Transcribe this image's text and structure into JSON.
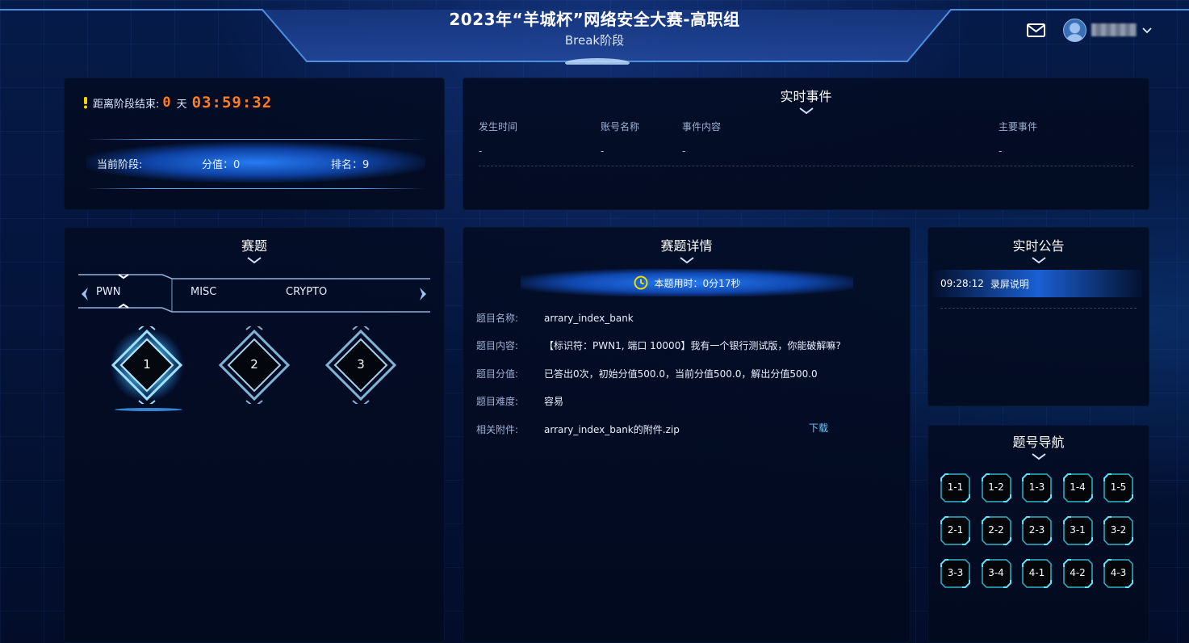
{
  "header": {
    "title": "2023年“羊城杯”网络安全大赛-高职组",
    "subtitle": "Break阶段",
    "username": "user"
  },
  "countdown": {
    "label": "距离阶段结束:",
    "days": "0",
    "days_unit": "天",
    "time": "03:59:32"
  },
  "stage": {
    "current_label": "当前阶段:",
    "score": "分值：0",
    "rank": "排名：9"
  },
  "events": {
    "title": "实时事件",
    "columns": [
      "发生时间",
      "账号名称",
      "事件内容",
      "主要事件"
    ],
    "row": [
      "-",
      "-",
      "-",
      "-"
    ]
  },
  "challenges": {
    "title": "赛题",
    "tabs": [
      "PWN",
      "MISC",
      "CRYPTO"
    ],
    "active_tab": "PWN",
    "items": [
      "1",
      "2",
      "3"
    ],
    "selected": "1"
  },
  "details": {
    "title": "赛题详情",
    "timer": "本题用时：0分17秒",
    "rows": [
      {
        "label": "题目名称:",
        "value": "arrary_index_bank"
      },
      {
        "label": "题目内容:",
        "value": "【标识符：PWN1, 端口 10000】我有一个银行测试版，你能破解嘛?"
      },
      {
        "label": "题目分值:",
        "value": "已答出0次，初始分值500.0，当前分值500.0，解出分值500.0"
      },
      {
        "label": "题目难度:",
        "value": "容易"
      },
      {
        "label": "相关附件:",
        "value": "arrary_index_bank的附件.zip"
      }
    ],
    "download": "下载"
  },
  "notices": {
    "title": "实时公告",
    "items": [
      {
        "time": "09:28:12",
        "text": "录屏说明"
      }
    ]
  },
  "nav": {
    "title": "题号导航",
    "items": [
      "1-1",
      "1-2",
      "1-3",
      "1-4",
      "1-5",
      "2-1",
      "2-2",
      "2-3",
      "3-1",
      "3-2",
      "3-3",
      "3-4",
      "4-1",
      "4-2",
      "4-3"
    ]
  },
  "colors": {
    "accent": "#1e7bff",
    "timer": "#ff7d1f",
    "link": "#6cc8ff"
  }
}
